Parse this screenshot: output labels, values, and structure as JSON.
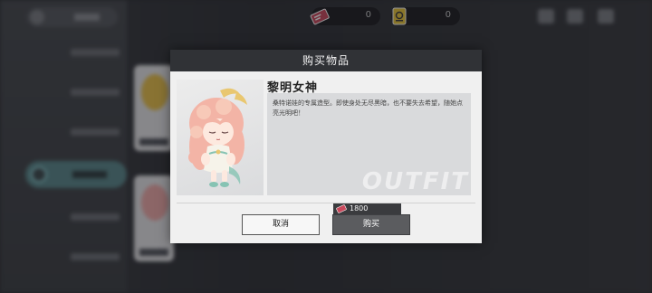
{
  "currencies": [
    {
      "icon": "red-ticket-icon",
      "amount": "0"
    },
    {
      "icon": "gold-card-icon",
      "amount": "0"
    }
  ],
  "dialog": {
    "title": "购买物品",
    "item_name": "黎明女神",
    "description": "桑特诺娃的专属造型。即使身处无尽黑暗，也不要失去希望，随她点亮光明吧！",
    "watermark": "OUTFIT",
    "price": "1800",
    "cancel_label": "取消",
    "buy_label": "购买"
  },
  "colors": {
    "header_bg": "#303236",
    "buy_button": "#5b5c5f",
    "accent_teal": "#59878a",
    "ticket_red": "#c9485b",
    "gold": "#e8c53a"
  }
}
